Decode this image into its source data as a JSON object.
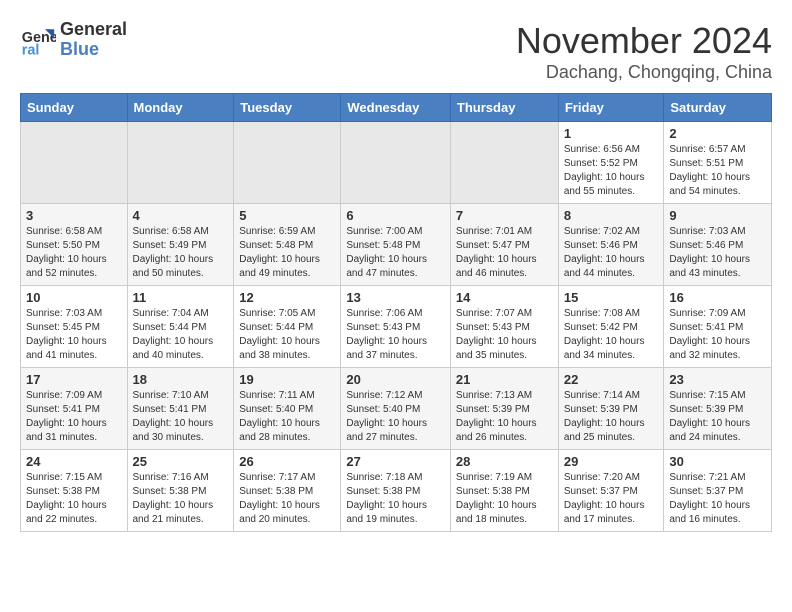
{
  "logo": {
    "line1": "General",
    "line2": "Blue"
  },
  "title": "November 2024",
  "subtitle": "Dachang, Chongqing, China",
  "days_of_week": [
    "Sunday",
    "Monday",
    "Tuesday",
    "Wednesday",
    "Thursday",
    "Friday",
    "Saturday"
  ],
  "weeks": [
    [
      {
        "day": "",
        "info": ""
      },
      {
        "day": "",
        "info": ""
      },
      {
        "day": "",
        "info": ""
      },
      {
        "day": "",
        "info": ""
      },
      {
        "day": "",
        "info": ""
      },
      {
        "day": "1",
        "info": "Sunrise: 6:56 AM\nSunset: 5:52 PM\nDaylight: 10 hours\nand 55 minutes."
      },
      {
        "day": "2",
        "info": "Sunrise: 6:57 AM\nSunset: 5:51 PM\nDaylight: 10 hours\nand 54 minutes."
      }
    ],
    [
      {
        "day": "3",
        "info": "Sunrise: 6:58 AM\nSunset: 5:50 PM\nDaylight: 10 hours\nand 52 minutes."
      },
      {
        "day": "4",
        "info": "Sunrise: 6:58 AM\nSunset: 5:49 PM\nDaylight: 10 hours\nand 50 minutes."
      },
      {
        "day": "5",
        "info": "Sunrise: 6:59 AM\nSunset: 5:48 PM\nDaylight: 10 hours\nand 49 minutes."
      },
      {
        "day": "6",
        "info": "Sunrise: 7:00 AM\nSunset: 5:48 PM\nDaylight: 10 hours\nand 47 minutes."
      },
      {
        "day": "7",
        "info": "Sunrise: 7:01 AM\nSunset: 5:47 PM\nDaylight: 10 hours\nand 46 minutes."
      },
      {
        "day": "8",
        "info": "Sunrise: 7:02 AM\nSunset: 5:46 PM\nDaylight: 10 hours\nand 44 minutes."
      },
      {
        "day": "9",
        "info": "Sunrise: 7:03 AM\nSunset: 5:46 PM\nDaylight: 10 hours\nand 43 minutes."
      }
    ],
    [
      {
        "day": "10",
        "info": "Sunrise: 7:03 AM\nSunset: 5:45 PM\nDaylight: 10 hours\nand 41 minutes."
      },
      {
        "day": "11",
        "info": "Sunrise: 7:04 AM\nSunset: 5:44 PM\nDaylight: 10 hours\nand 40 minutes."
      },
      {
        "day": "12",
        "info": "Sunrise: 7:05 AM\nSunset: 5:44 PM\nDaylight: 10 hours\nand 38 minutes."
      },
      {
        "day": "13",
        "info": "Sunrise: 7:06 AM\nSunset: 5:43 PM\nDaylight: 10 hours\nand 37 minutes."
      },
      {
        "day": "14",
        "info": "Sunrise: 7:07 AM\nSunset: 5:43 PM\nDaylight: 10 hours\nand 35 minutes."
      },
      {
        "day": "15",
        "info": "Sunrise: 7:08 AM\nSunset: 5:42 PM\nDaylight: 10 hours\nand 34 minutes."
      },
      {
        "day": "16",
        "info": "Sunrise: 7:09 AM\nSunset: 5:41 PM\nDaylight: 10 hours\nand 32 minutes."
      }
    ],
    [
      {
        "day": "17",
        "info": "Sunrise: 7:09 AM\nSunset: 5:41 PM\nDaylight: 10 hours\nand 31 minutes."
      },
      {
        "day": "18",
        "info": "Sunrise: 7:10 AM\nSunset: 5:41 PM\nDaylight: 10 hours\nand 30 minutes."
      },
      {
        "day": "19",
        "info": "Sunrise: 7:11 AM\nSunset: 5:40 PM\nDaylight: 10 hours\nand 28 minutes."
      },
      {
        "day": "20",
        "info": "Sunrise: 7:12 AM\nSunset: 5:40 PM\nDaylight: 10 hours\nand 27 minutes."
      },
      {
        "day": "21",
        "info": "Sunrise: 7:13 AM\nSunset: 5:39 PM\nDaylight: 10 hours\nand 26 minutes."
      },
      {
        "day": "22",
        "info": "Sunrise: 7:14 AM\nSunset: 5:39 PM\nDaylight: 10 hours\nand 25 minutes."
      },
      {
        "day": "23",
        "info": "Sunrise: 7:15 AM\nSunset: 5:39 PM\nDaylight: 10 hours\nand 24 minutes."
      }
    ],
    [
      {
        "day": "24",
        "info": "Sunrise: 7:15 AM\nSunset: 5:38 PM\nDaylight: 10 hours\nand 22 minutes."
      },
      {
        "day": "25",
        "info": "Sunrise: 7:16 AM\nSunset: 5:38 PM\nDaylight: 10 hours\nand 21 minutes."
      },
      {
        "day": "26",
        "info": "Sunrise: 7:17 AM\nSunset: 5:38 PM\nDaylight: 10 hours\nand 20 minutes."
      },
      {
        "day": "27",
        "info": "Sunrise: 7:18 AM\nSunset: 5:38 PM\nDaylight: 10 hours\nand 19 minutes."
      },
      {
        "day": "28",
        "info": "Sunrise: 7:19 AM\nSunset: 5:38 PM\nDaylight: 10 hours\nand 18 minutes."
      },
      {
        "day": "29",
        "info": "Sunrise: 7:20 AM\nSunset: 5:37 PM\nDaylight: 10 hours\nand 17 minutes."
      },
      {
        "day": "30",
        "info": "Sunrise: 7:21 AM\nSunset: 5:37 PM\nDaylight: 10 hours\nand 16 minutes."
      }
    ]
  ]
}
